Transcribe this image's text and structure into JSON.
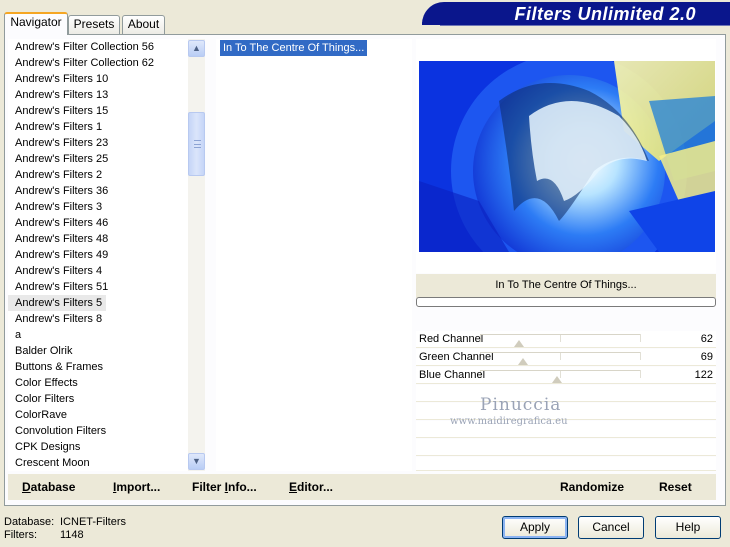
{
  "tabs": [
    {
      "label": "Navigator",
      "active": true
    },
    {
      "label": "Presets",
      "active": false
    },
    {
      "label": "About",
      "active": false
    }
  ],
  "header": {
    "title": "Filters Unlimited 2.0"
  },
  "categories": [
    {
      "label": "Andrew's Filter Collection 56",
      "selected": false
    },
    {
      "label": "Andrew's Filter Collection 62",
      "selected": false
    },
    {
      "label": "Andrew's Filters 10",
      "selected": false
    },
    {
      "label": "Andrew's Filters 13",
      "selected": false
    },
    {
      "label": "Andrew's Filters 15",
      "selected": false
    },
    {
      "label": "Andrew's Filters 1",
      "selected": false
    },
    {
      "label": "Andrew's Filters 23",
      "selected": false
    },
    {
      "label": "Andrew's Filters 25",
      "selected": false
    },
    {
      "label": "Andrew's Filters 2",
      "selected": false
    },
    {
      "label": "Andrew's Filters 36",
      "selected": false
    },
    {
      "label": "Andrew's Filters 3",
      "selected": false
    },
    {
      "label": "Andrew's Filters 46",
      "selected": false
    },
    {
      "label": "Andrew's Filters 48",
      "selected": false
    },
    {
      "label": "Andrew's Filters 49",
      "selected": false
    },
    {
      "label": "Andrew's Filters 4",
      "selected": false
    },
    {
      "label": "Andrew's Filters 51",
      "selected": false
    },
    {
      "label": "Andrew's Filters 5",
      "selected": true
    },
    {
      "label": "Andrew's Filters 8",
      "selected": false
    },
    {
      "label": "a",
      "selected": false
    },
    {
      "label": "Balder Olrik",
      "selected": false
    },
    {
      "label": "Buttons & Frames",
      "selected": false
    },
    {
      "label": "Color Effects",
      "selected": false
    },
    {
      "label": "Color Filters",
      "selected": false
    },
    {
      "label": "ColorRave",
      "selected": false
    },
    {
      "label": "Convolution Filters",
      "selected": false
    },
    {
      "label": "CPK Designs",
      "selected": false
    },
    {
      "label": "Crescent Moon",
      "selected": false
    }
  ],
  "filters": [
    {
      "label": "In To The Centre Of Things...",
      "selected": true
    }
  ],
  "preview": {
    "filter_name": "In To The Centre Of Things...",
    "progress": 0
  },
  "sliders": [
    {
      "label": "Red Channel",
      "value": "62",
      "level": 62
    },
    {
      "label": "Green Channel",
      "value": "69",
      "level": 69
    },
    {
      "label": "Blue Channel",
      "value": "122",
      "level": 122
    }
  ],
  "watermark": {
    "name": "Pinuccia",
    "url": "www.maidiregrafica.eu"
  },
  "toolbar": {
    "database": {
      "label": "Database",
      "underline": "D",
      "rest": "atabase"
    },
    "import": {
      "label": "Import...",
      "underline": "I",
      "rest": "mport..."
    },
    "filter_info": {
      "label": "Filter Info...",
      "prefix": "Filter ",
      "underline": "I",
      "rest": "nfo..."
    },
    "editor": {
      "label": "Editor...",
      "underline": "E",
      "rest": "ditor..."
    },
    "randomize": "Randomize",
    "reset": "Reset"
  },
  "status": {
    "database_label": "Database:",
    "database_value": "ICNET-Filters",
    "filters_label": "Filters:",
    "filters_value": "1148"
  },
  "buttons": {
    "apply": "Apply",
    "cancel": "Cancel",
    "help": "Help"
  }
}
